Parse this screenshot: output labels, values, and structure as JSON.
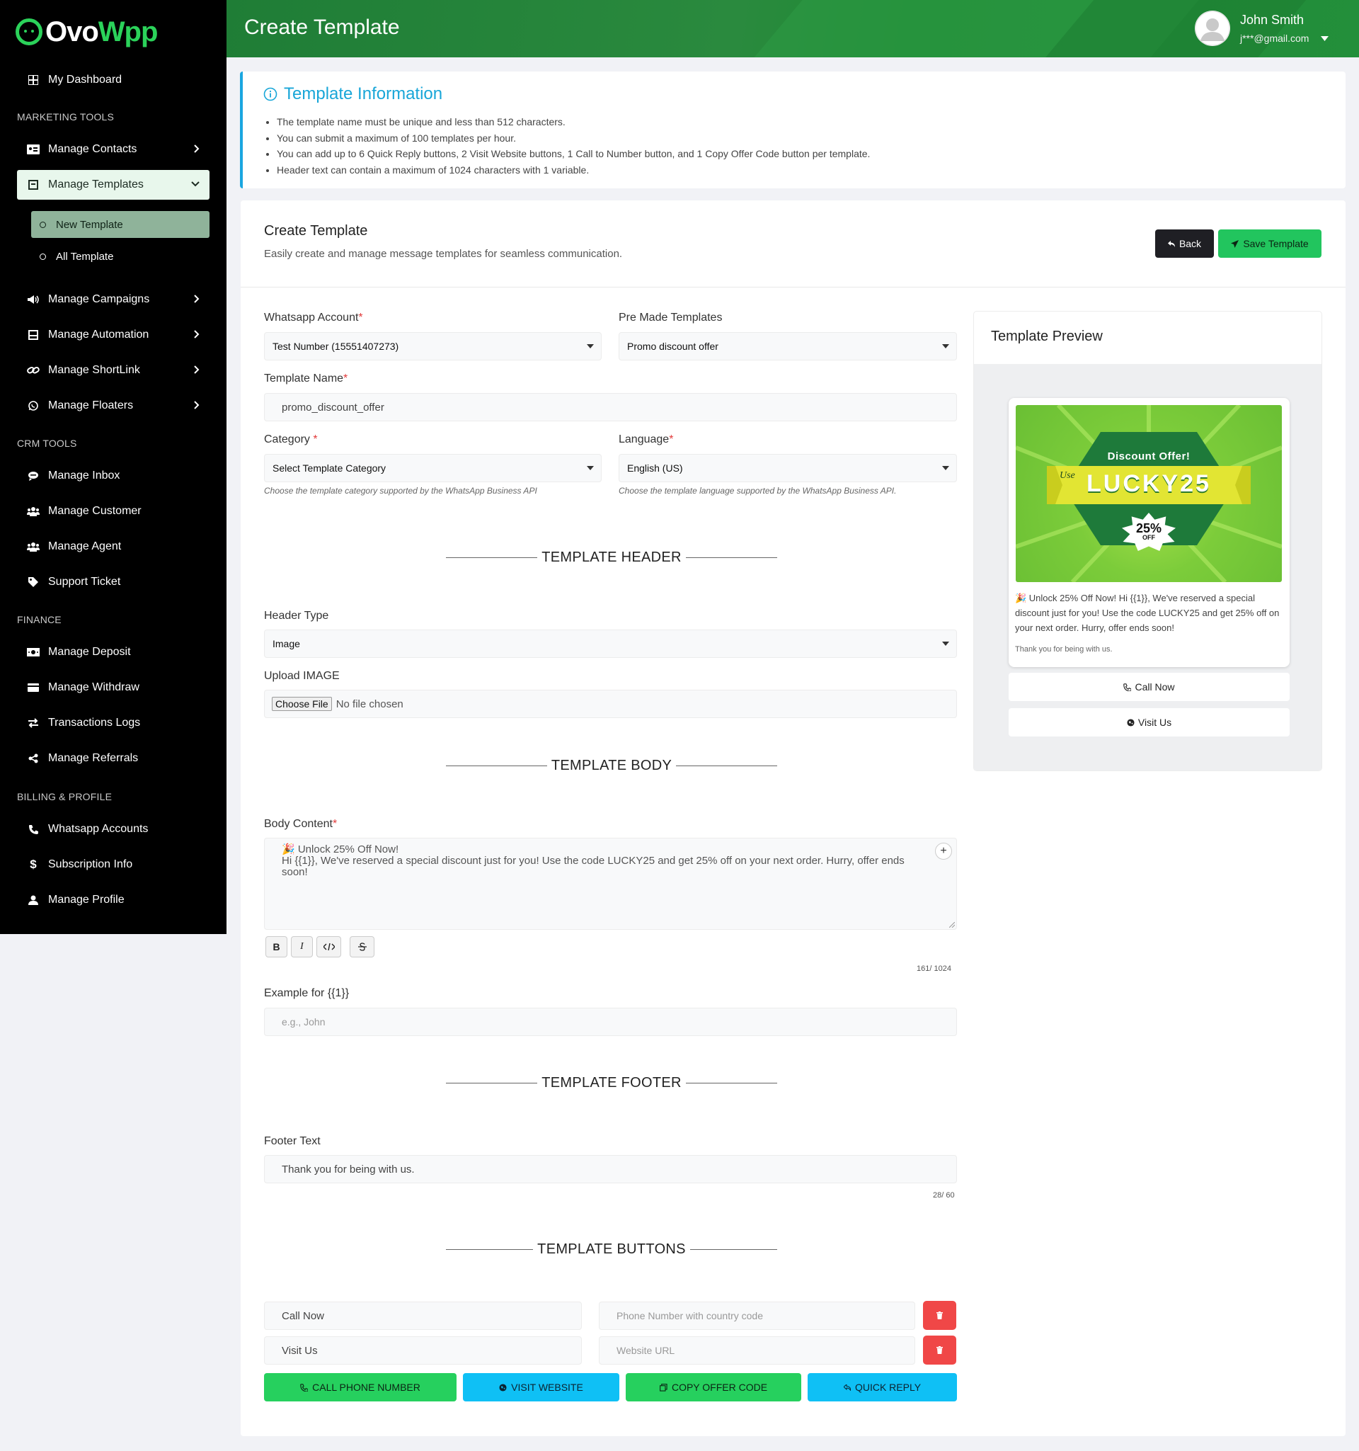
{
  "app": {
    "logo_part1": "Ovo",
    "logo_part2": "Wpp",
    "brand_color": "#2bd25a",
    "accent_color": "#18a6d8"
  },
  "sidebar": {
    "dashboard": "My Dashboard",
    "section_marketing": "MARKETING TOOLS",
    "manage_contacts": "Manage Contacts",
    "manage_templates": "Manage Templates",
    "new_template": "New Template",
    "all_template": "All Template",
    "manage_campaigns": "Manage Campaigns",
    "manage_automation": "Manage Automation",
    "manage_shortlink": "Manage ShortLink",
    "manage_floaters": "Manage Floaters",
    "section_crm": "CRM TOOLS",
    "manage_inbox": "Manage Inbox",
    "manage_customer": "Manage Customer",
    "manage_agent": "Manage Agent",
    "support_ticket": "Support Ticket",
    "section_finance": "FINANCE",
    "manage_deposit": "Manage Deposit",
    "manage_withdraw": "Manage Withdraw",
    "transactions_logs": "Transactions Logs",
    "manage_referrals": "Manage Referrals",
    "section_billing": "BILLING & PROFILE",
    "whatsapp_accounts": "Whatsapp Accounts",
    "subscription_info": "Subscription Info",
    "manage_profile": "Manage Profile"
  },
  "header": {
    "title": "Create Template",
    "user_name": "John Smith",
    "user_email": "j***@gmail.com"
  },
  "info": {
    "title": "Template Information",
    "items": [
      "The template name must be unique and less than 512 characters.",
      "You can submit a maximum of 100 templates per hour.",
      "You can add up to 6 Quick Reply buttons, 2 Visit Website buttons, 1 Call to Number button, and 1 Copy Offer Code button per template.",
      "Header text can contain a maximum of 1024 characters with 1 variable."
    ]
  },
  "form": {
    "title": "Create Template",
    "subtitle": "Easily create and manage message templates for seamless communication.",
    "back_label": "Back",
    "save_label": "Save Template",
    "whatsapp_account_label": "Whatsapp Account",
    "whatsapp_account_value": "Test Number (15551407273)",
    "premade_label": "Pre Made Templates",
    "premade_value": "Promo discount offer",
    "template_name_label": "Template Name",
    "template_name_value": "promo_discount_offer",
    "category_label": "Category",
    "category_value": "Select Template Category",
    "category_hint": "Choose the template category supported by the WhatsApp Business API",
    "language_label": "Language",
    "language_value": "English (US)",
    "language_hint": "Choose the template language supported by the WhatsApp Business API.",
    "section_header": "TEMPLATE HEADER",
    "header_type_label": "Header Type",
    "header_type_value": "Image",
    "upload_label": "Upload IMAGE",
    "choose_file": "Choose File",
    "no_file": "No file chosen",
    "section_body": "TEMPLATE BODY",
    "body_label": "Body Content",
    "body_line1": "🎉 Unlock 25% Off Now!",
    "body_line2": "Hi {{1}}, We've reserved a special discount just for you! Use the code LUCKY25 and get 25% off on your next order. Hurry, offer ends soon!",
    "fmt_bold": "B",
    "fmt_italic": "I",
    "body_counter": "161/ 1024",
    "example_label": "Example for {{1}}",
    "example_placeholder": "e.g., John",
    "section_footer": "TEMPLATE FOOTER",
    "footer_label": "Footer Text",
    "footer_value": "Thank you for being with us.",
    "footer_counter": "28/ 60",
    "section_buttons": "TEMPLATE BUTTONS",
    "button1_text": "Call Now",
    "button1_placeholder": "Phone Number with country code",
    "button2_text": "Visit Us",
    "button2_placeholder": "Website URL",
    "add_call": "CALL PHONE NUMBER",
    "add_visit": "VISIT WEBSITE",
    "add_copy": "COPY OFFER CODE",
    "add_quick": "QUICK REPLY"
  },
  "preview": {
    "title": "Template Preview",
    "image_discount": "Discount Offer!",
    "image_use": "Use",
    "image_code": "LUCKY25",
    "image_pct": "25%",
    "image_off": "OFF",
    "body": "🎉 Unlock 25% Off Now! Hi {{1}}, We've reserved a special discount just for you! Use the code LUCKY25 and get 25% off on your next order. Hurry, offer ends soon!",
    "footer": "Thank you for being with us.",
    "btn_call": "Call Now",
    "btn_visit": "Visit Us"
  }
}
